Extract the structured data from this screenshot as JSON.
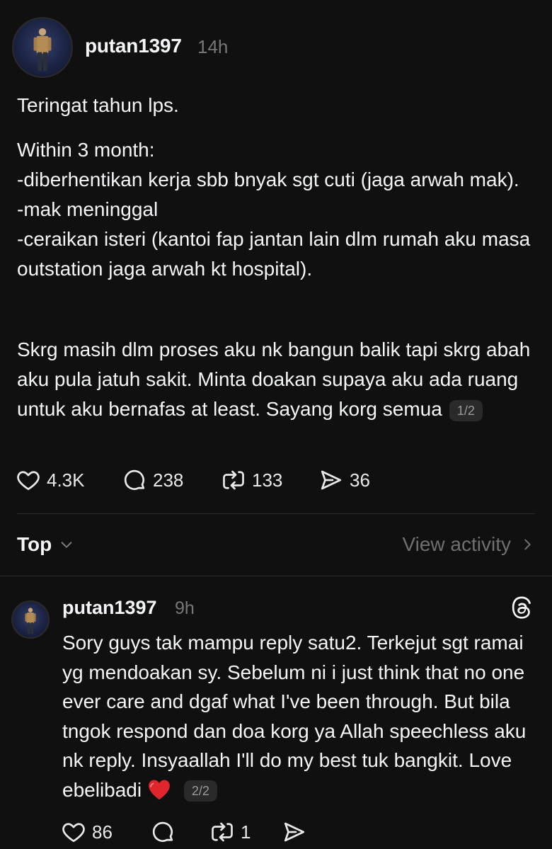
{
  "post": {
    "username": "putan1397",
    "time": "14h",
    "paragraph1": "Teringat tahun lps.",
    "lines": [
      "Within 3 month:",
      "-diberhentikan kerja sbb bnyak sgt cuti (jaga arwah mak).",
      "-mak meninggal",
      "-ceraikan isteri (kantoi fap jantan lain dlm rumah aku masa outstation jaga arwah kt hospital)."
    ],
    "paragraph3": "Skrg masih dlm proses aku nk bangun balik tapi skrg abah aku pula jatuh sakit. Minta doakan supaya aku ada ruang untuk aku bernafas at least. Sayang korg semua",
    "page_badge": "1/2",
    "likes": "4.3K",
    "comments": "238",
    "reposts": "133",
    "shares": "36"
  },
  "replies_header": {
    "sort_label": "Top",
    "view_activity": "View activity"
  },
  "reply": {
    "username": "putan1397",
    "time": "9h",
    "text": "Sory guys tak mampu reply satu2.  Terkejut sgt ramai yg mendoakan sy. Sebelum ni i just think that no one ever care and dgaf what I've been through. But bila tngok respond dan doa korg ya Allah speechless aku nk reply. Insyaallah I'll do my best tuk bangkit. Love ebelibadi",
    "page_badge": "2/2",
    "likes": "86",
    "reposts": "1"
  },
  "icons": {
    "like": "heart-icon",
    "comment": "comment-bubble-icon",
    "repost": "repost-icon",
    "share": "send-icon",
    "threads": "threads-logo-icon",
    "sort": "chevron-down-icon",
    "activity": "chevron-right-icon",
    "emoji": "red-heart-emoji"
  },
  "colors": {
    "background": "#101010",
    "text": "#f3f5f7",
    "muted": "#777777",
    "divider": "#2a2a2a"
  }
}
